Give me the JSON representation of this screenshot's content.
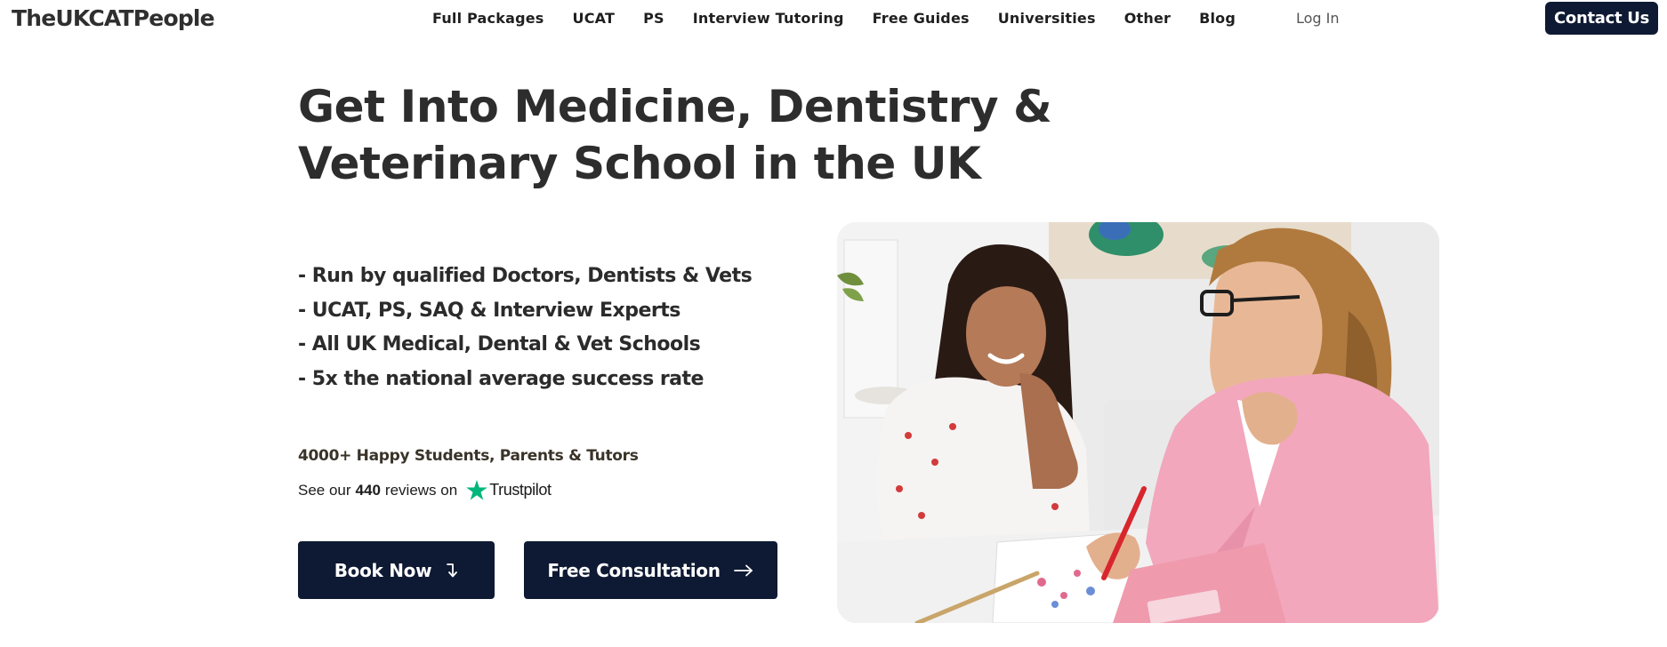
{
  "brand": {
    "logo": "TheUKCATPeople"
  },
  "nav": {
    "links": [
      "Full Packages",
      "UCAT",
      "PS",
      "Interview Tutoring",
      "Free Guides",
      "Universities",
      "Other",
      "Blog"
    ],
    "login": "Log In",
    "contact": "Contact Us"
  },
  "hero": {
    "title": "Get Into Medicine, Dentistry & Veterinary School in the UK",
    "bullets": [
      "- Run by qualified Doctors, Dentists & Vets",
      "- UCAT, PS, SAQ & Interview Experts",
      "- All UK Medical, Dental & Vet Schools",
      "- 5x the national average success rate"
    ],
    "social_proof": "4000+ Happy Students, Parents & Tutors",
    "reviews": {
      "prefix": "See our",
      "count": "440",
      "suffix": "reviews on",
      "platform": "Trustpilot"
    },
    "buttons": {
      "book": "Book Now",
      "consult": "Free Consultation"
    }
  },
  "colors": {
    "navy": "#0e1a33",
    "trustpilot_green": "#00b67a",
    "jacket_pink": "#f2a7bc"
  },
  "icons": {
    "book_arrow": "arrow-down-hook-icon",
    "consult_arrow": "arrow-right-icon",
    "trustpilot": "trustpilot-star-icon"
  }
}
